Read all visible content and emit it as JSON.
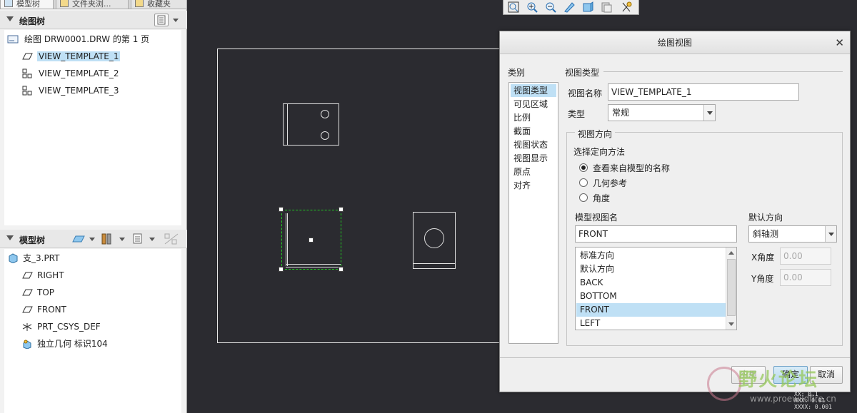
{
  "left_panel": {
    "tabs": [
      "模型树",
      "文件夹浏...",
      "收藏夹"
    ],
    "drawing_tree": {
      "title": "绘图树",
      "root": "绘图 DRW0001.DRW 的第 1 页",
      "items": [
        {
          "label": "VIEW_TEMPLATE_1",
          "selected": true
        },
        {
          "label": "VIEW_TEMPLATE_2",
          "selected": false
        },
        {
          "label": "VIEW_TEMPLATE_3",
          "selected": false
        }
      ]
    },
    "model_tree": {
      "title": "模型树",
      "root": "支_3.PRT",
      "items": [
        {
          "label": "RIGHT",
          "icon": "datum-plane-icon"
        },
        {
          "label": "TOP",
          "icon": "datum-plane-icon"
        },
        {
          "label": "FRONT",
          "icon": "datum-plane-icon"
        },
        {
          "label": "PRT_CSYS_DEF",
          "icon": "csys-icon"
        },
        {
          "label": "独立几何 标识104",
          "icon": "independent-geometry-icon"
        }
      ]
    }
  },
  "dialog": {
    "title": "绘图视图",
    "category_label": "类别",
    "categories": [
      {
        "label": "视图类型",
        "selected": true
      },
      {
        "label": "可见区域",
        "selected": false
      },
      {
        "label": "比例",
        "selected": false
      },
      {
        "label": "截面",
        "selected": false
      },
      {
        "label": "视图状态",
        "selected": false
      },
      {
        "label": "视图显示",
        "selected": false
      },
      {
        "label": "原点",
        "selected": false
      },
      {
        "label": "对齐",
        "selected": false
      }
    ],
    "view_type_group": "视图类型",
    "view_name_label": "视图名称",
    "view_name_value": "VIEW_TEMPLATE_1",
    "type_label": "类型",
    "type_value": "常规",
    "orientation_group": "视图方向",
    "orient_method_label": "选择定向方法",
    "radios": [
      {
        "label": "查看来自模型的名称",
        "checked": true
      },
      {
        "label": "几何参考",
        "checked": false
      },
      {
        "label": "角度",
        "checked": false
      }
    ],
    "model_view_name_label": "模型视图名",
    "model_view_name_value": "FRONT",
    "model_views": [
      {
        "label": "标准方向",
        "selected": false
      },
      {
        "label": "默认方向",
        "selected": false
      },
      {
        "label": "BACK",
        "selected": false
      },
      {
        "label": "BOTTOM",
        "selected": false
      },
      {
        "label": "FRONT",
        "selected": true
      },
      {
        "label": "LEFT",
        "selected": false
      }
    ],
    "default_orient_label": "默认方向",
    "default_orient_value": "斜轴测",
    "x_angle_label": "X角度",
    "x_angle_value": "0.00",
    "y_angle_label": "Y角度",
    "y_angle_value": "0.00",
    "buttons": {
      "apply": "应用",
      "ok": "确定",
      "cancel": "取消"
    }
  },
  "watermark": {
    "text": "野火论坛",
    "url": "www.proewildfire.cn"
  },
  "status_lines": [
    "XX: 0.1",
    "XXX: 0.01",
    "XXXX: 0.001"
  ],
  "colors": {
    "canvas": "#2b2b30",
    "selection": "#bfe0f5",
    "geometry": "#e0e0e0",
    "selected_view": "#22cc22"
  }
}
